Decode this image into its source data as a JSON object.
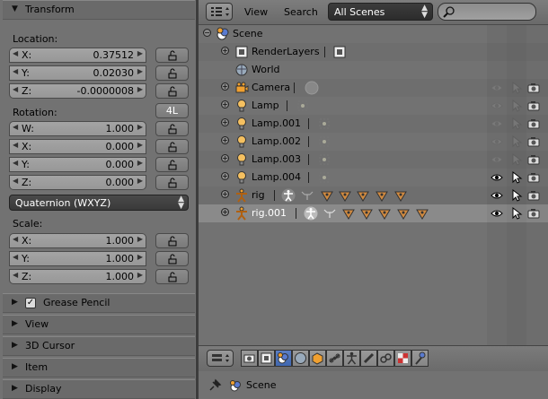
{
  "transform_panel": {
    "title": "Transform",
    "location_label": "Location:",
    "location": [
      {
        "key": "X:",
        "value": "0.37512"
      },
      {
        "key": "Y:",
        "value": "0.02030"
      },
      {
        "key": "Z:",
        "value": "-0.0000008"
      }
    ],
    "rotation_label": "Rotation:",
    "rotation_4l_label": "4L",
    "rotation": [
      {
        "key": "W:",
        "value": "1.000"
      },
      {
        "key": "X:",
        "value": "0.000"
      },
      {
        "key": "Y:",
        "value": "0.000"
      },
      {
        "key": "Z:",
        "value": "0.000"
      }
    ],
    "rotation_mode": "Quaternion (WXYZ)",
    "scale_label": "Scale:",
    "scale": [
      {
        "key": "X:",
        "value": "1.000"
      },
      {
        "key": "Y:",
        "value": "1.000"
      },
      {
        "key": "Z:",
        "value": "1.000"
      }
    ]
  },
  "collapsed_panels": {
    "grease_pencil": "Grease Pencil",
    "view": "View",
    "cursor_3d": "3D Cursor",
    "item": "Item",
    "display": "Display"
  },
  "outliner": {
    "menu_view": "View",
    "menu_search": "Search",
    "display_mode": "All Scenes",
    "search_placeholder": "",
    "rows": [
      {
        "name": "Scene"
      },
      {
        "name": "RenderLayers"
      },
      {
        "name": "World"
      },
      {
        "name": "Camera"
      },
      {
        "name": "Lamp"
      },
      {
        "name": "Lamp.001"
      },
      {
        "name": "Lamp.002"
      },
      {
        "name": "Lamp.003"
      },
      {
        "name": "Lamp.004"
      },
      {
        "name": "rig"
      },
      {
        "name": "rig.001"
      }
    ]
  },
  "breadcrumb": {
    "scene": "Scene"
  },
  "colors": {
    "active_tab": "#4a72bb",
    "panel_bg": "#727272",
    "dropdown_bg": "#333333"
  }
}
